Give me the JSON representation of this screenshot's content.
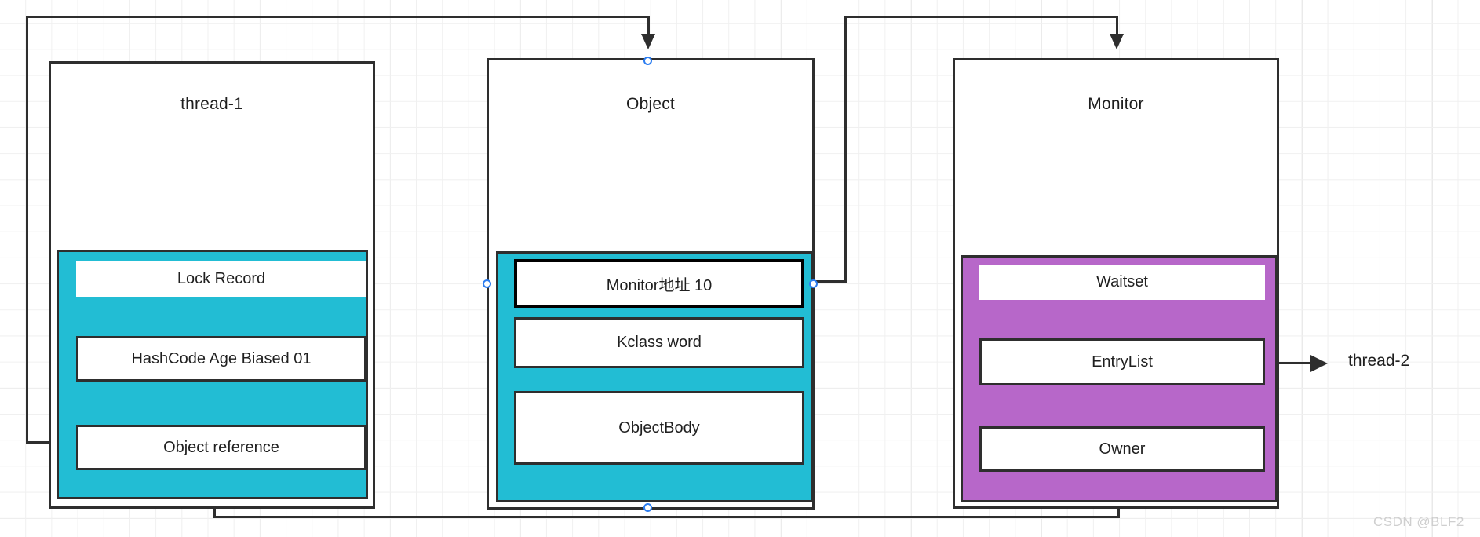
{
  "diagram": {
    "title_thread1": "thread-1",
    "title_object": "Object",
    "title_monitor": "Monitor",
    "colors": {
      "cyan": "#22bdd4",
      "purple": "#b767c9",
      "stroke": "#2e2e2e",
      "endpoint": "#2c7df0",
      "background": "#ffffff"
    },
    "thread1": {
      "label": "thread-1",
      "rows": [
        {
          "label": "Lock Record"
        },
        {
          "label": "HashCode Age Biased 01"
        },
        {
          "label": "Object reference"
        }
      ]
    },
    "object": {
      "label": "Object",
      "rows": [
        {
          "label": "Monitor地址 10"
        },
        {
          "label": "Kclass word"
        },
        {
          "label": "ObjectBody"
        }
      ]
    },
    "monitor": {
      "label": "Monitor",
      "rows": [
        {
          "label": "Waitset"
        },
        {
          "label": "EntryList"
        },
        {
          "label": "Owner"
        }
      ]
    },
    "external": {
      "thread2": "thread-2"
    },
    "watermark": "CSDN @BLF2"
  }
}
